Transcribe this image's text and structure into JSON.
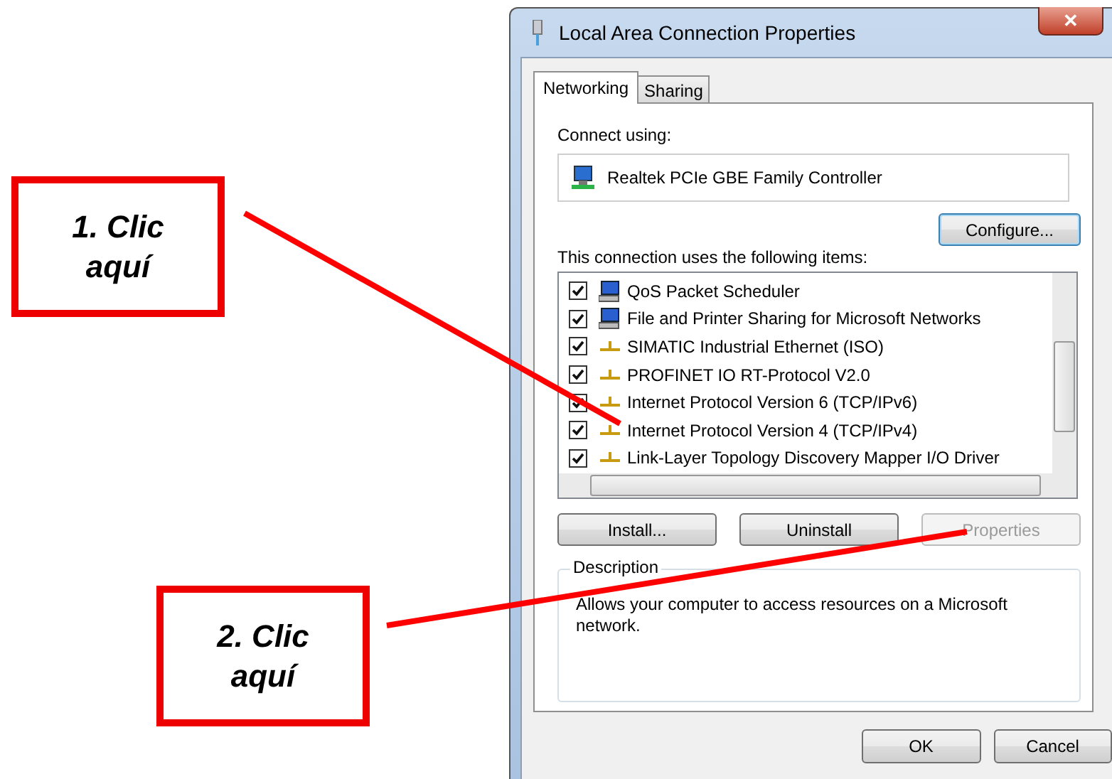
{
  "annotations": [
    {
      "text": "1. Clic aquí"
    },
    {
      "text": "2. Clic aquí"
    }
  ],
  "window": {
    "title": "Local Area Connection Properties",
    "close": "✕"
  },
  "tabs": [
    {
      "label": "Networking",
      "selected": true
    },
    {
      "label": "Sharing",
      "selected": false
    }
  ],
  "connect_using": {
    "label": "Connect using:",
    "adapter": "Realtek PCIe GBE Family Controller",
    "configure_button": "Configure..."
  },
  "items_label": "This connection uses the following items:",
  "items": [
    {
      "label": "QoS Packet Scheduler",
      "kind": "client",
      "checked": true
    },
    {
      "label": "File and Printer Sharing for Microsoft Networks",
      "kind": "client",
      "checked": true
    },
    {
      "label": "SIMATIC Industrial Ethernet (ISO)",
      "kind": "protocol",
      "checked": true
    },
    {
      "label": "PROFINET IO RT-Protocol V2.0",
      "kind": "protocol",
      "checked": true
    },
    {
      "label": "Internet Protocol Version 6 (TCP/IPv6)",
      "kind": "protocol",
      "checked": true
    },
    {
      "label": "Internet Protocol Version 4 (TCP/IPv4)",
      "kind": "protocol",
      "checked": true
    },
    {
      "label": "Link-Layer Topology Discovery Mapper I/O Driver",
      "kind": "protocol",
      "checked": true
    }
  ],
  "item_buttons": [
    {
      "label": "Install...",
      "disabled": false
    },
    {
      "label": "Uninstall",
      "disabled": false
    },
    {
      "label": "Properties",
      "disabled": true
    }
  ],
  "description": {
    "legend": "Description",
    "text": "Allows your computer to access resources on a Microsoft network."
  },
  "buttons": [
    "OK",
    "Cancel"
  ]
}
